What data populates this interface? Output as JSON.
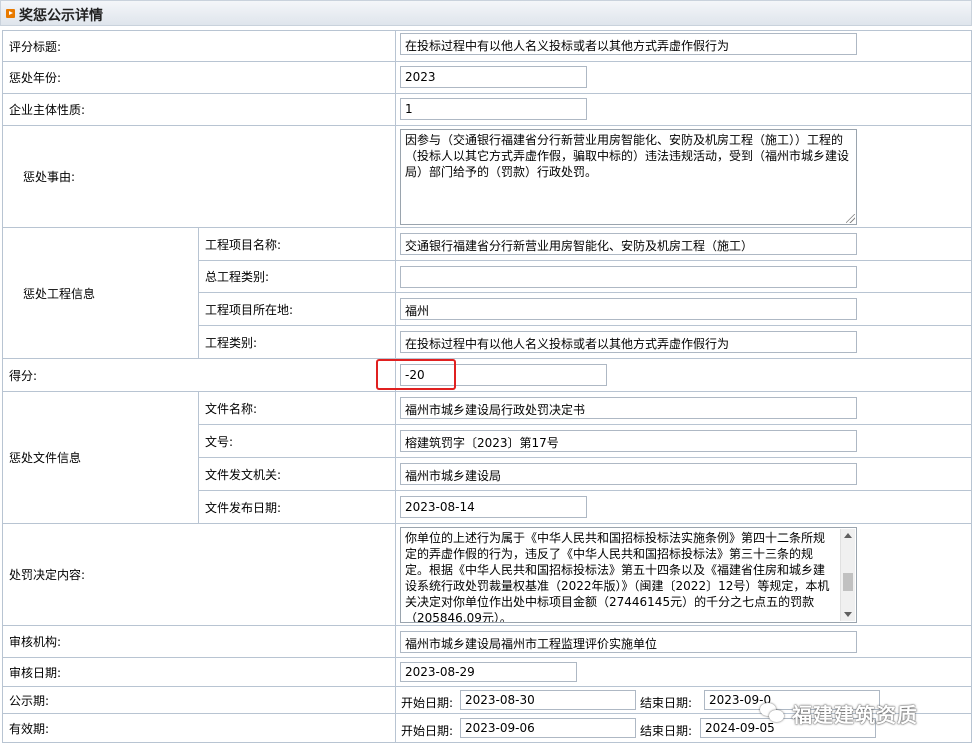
{
  "header": {
    "title": "奖惩公示详情"
  },
  "rows": {
    "score_title": {
      "label": "评分标题:",
      "value": "在投标过程中有以他人名义投标或者以其他方式弄虚作假行为"
    },
    "year": {
      "label": "惩处年份:",
      "value": "2023"
    },
    "nature": {
      "label": "企业主体性质:",
      "value": "1"
    },
    "reason": {
      "label": "惩处事由:",
      "value": "因参与（交通银行福建省分行新营业用房智能化、安防及机房工程（施工））工程的（投标人以其它方式弄虚作假，骗取中标的）违法违规活动，受到（福州市城乡建设局）部门给予的（罚款）行政处罚。"
    },
    "project_info": {
      "label": "惩处工程信息",
      "name": {
        "label": "工程项目名称:",
        "value": "交通银行福建省分行新营业用房智能化、安防及机房工程（施工）"
      },
      "category": {
        "label": "总工程类别:",
        "value": ""
      },
      "location": {
        "label": "工程项目所在地:",
        "value": "福州"
      },
      "type": {
        "label": "工程类别:",
        "value": "在投标过程中有以他人名义投标或者以其他方式弄虚作假行为"
      }
    },
    "score": {
      "label": "得分:",
      "value": "-20"
    },
    "doc_info": {
      "label": "惩处文件信息",
      "name": {
        "label": "文件名称:",
        "value": "福州市城乡建设局行政处罚决定书"
      },
      "number": {
        "label": "文号:",
        "value": "榕建筑罚字〔2023〕第17号"
      },
      "issuer": {
        "label": "文件发文机关:",
        "value": "福州市城乡建设局"
      },
      "date": {
        "label": "文件发布日期:",
        "value": "2023-08-14"
      }
    },
    "penalty": {
      "label": "处罚决定内容:",
      "value": "你单位的上述行为属于《中华人民共和国招标投标法实施条例》第四十二条所规定的弄虚作假的行为，违反了《中华人民共和国招标投标法》第三十三条的规定。根据《中华人民共和国招标投标法》第五十四条以及《福建省住房和城乡建设系统行政处罚裁量权基准（2022年版）》（闽建〔2022〕12号）等规定，本机关决定对你单位作出处中标项目金额（27446145元）的千分之七点五的罚款（205846.09元）。"
    },
    "review_org": {
      "label": "审核机构:",
      "value": "福州市城乡建设局福州市工程监理评价实施单位"
    },
    "review_date": {
      "label": "审核日期:",
      "value": "2023-08-29"
    },
    "publicity": {
      "label": "公示期:",
      "start_label": "开始日期:",
      "start": "2023-08-30",
      "end_label": "结束日期:",
      "end": "2023-09-0"
    },
    "validity": {
      "label": "有效期:",
      "start_label": "开始日期:",
      "start": "2023-09-06",
      "end_label": "结束日期:",
      "end": "2024-09-05"
    }
  },
  "watermark": {
    "text": "福建建筑资质"
  }
}
